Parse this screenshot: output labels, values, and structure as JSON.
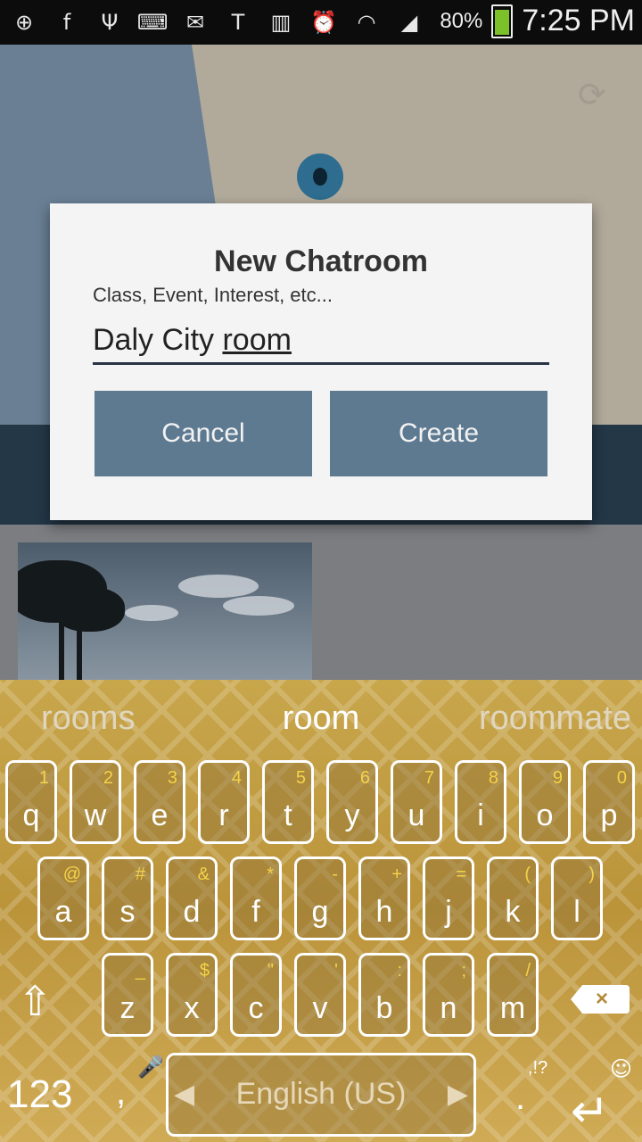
{
  "status_bar": {
    "icons": [
      "add-icon",
      "facebook-icon",
      "usb-icon",
      "keyboard-icon",
      "gmail-icon",
      "tmobile-icon",
      "nfc-icon",
      "alarm-icon",
      "wifi-icon",
      "signal-icon"
    ],
    "battery_text": "80%",
    "time": "7:25 PM"
  },
  "dialog": {
    "title": "New Chatroom",
    "subtitle": "Class, Event, Interest, etc...",
    "input_prefix": "Daly City ",
    "input_word": "room",
    "cancel_label": "Cancel",
    "create_label": "Create"
  },
  "keyboard": {
    "suggestions": [
      "rooms",
      "room",
      "roommate"
    ],
    "row1": [
      {
        "key": "q",
        "alt": "1"
      },
      {
        "key": "w",
        "alt": "2"
      },
      {
        "key": "e",
        "alt": "3"
      },
      {
        "key": "r",
        "alt": "4"
      },
      {
        "key": "t",
        "alt": "5"
      },
      {
        "key": "y",
        "alt": "6"
      },
      {
        "key": "u",
        "alt": "7"
      },
      {
        "key": "i",
        "alt": "8"
      },
      {
        "key": "o",
        "alt": "9"
      },
      {
        "key": "p",
        "alt": "0"
      }
    ],
    "row2": [
      {
        "key": "a",
        "alt": "@"
      },
      {
        "key": "s",
        "alt": "#"
      },
      {
        "key": "d",
        "alt": "&"
      },
      {
        "key": "f",
        "alt": "*"
      },
      {
        "key": "g",
        "alt": "-"
      },
      {
        "key": "h",
        "alt": "+"
      },
      {
        "key": "j",
        "alt": "="
      },
      {
        "key": "k",
        "alt": "("
      },
      {
        "key": "l",
        "alt": ")"
      }
    ],
    "row3": [
      {
        "key": "z",
        "alt": "_"
      },
      {
        "key": "x",
        "alt": "$"
      },
      {
        "key": "c",
        "alt": "\""
      },
      {
        "key": "v",
        "alt": "'"
      },
      {
        "key": "b",
        "alt": ":"
      },
      {
        "key": "n",
        "alt": ";"
      },
      {
        "key": "m",
        "alt": "/"
      }
    ],
    "num_label": "123",
    "comma": ",",
    "space_label": "English (US)",
    "period": ".",
    "punct_label": ",!?"
  }
}
